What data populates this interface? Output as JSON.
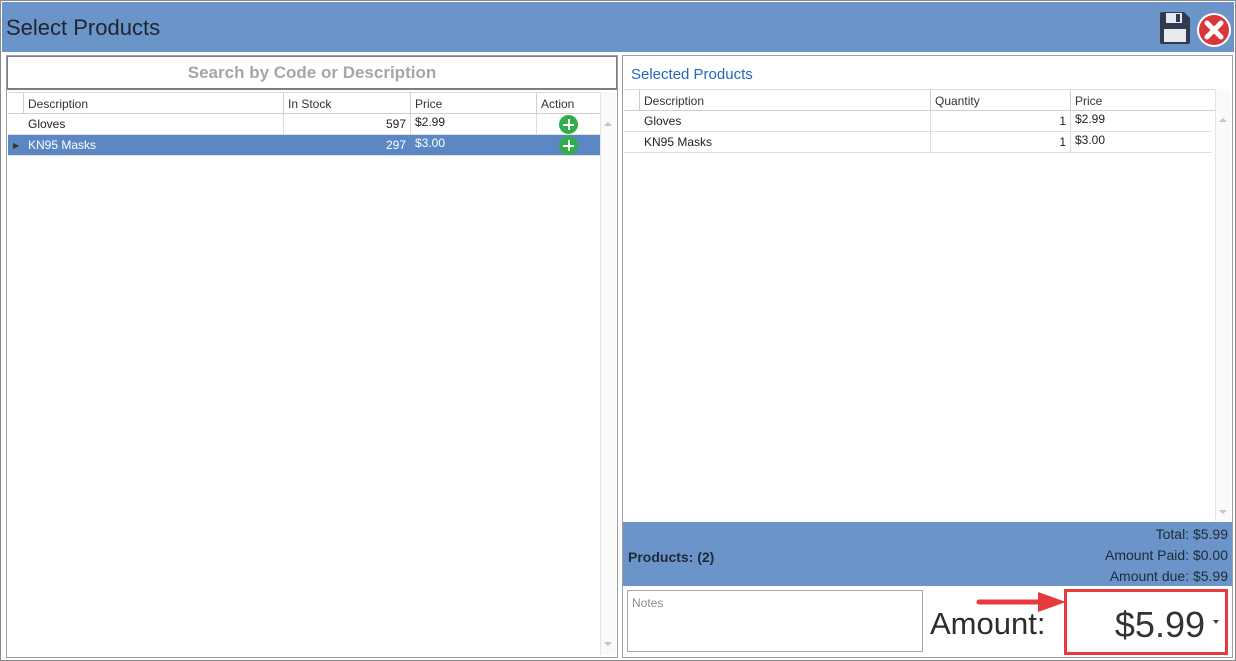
{
  "window": {
    "title": "Select Products"
  },
  "toolbar": {
    "save_icon": "floppy-disk-icon",
    "close_icon": "close-x-icon"
  },
  "search": {
    "placeholder": "Search by Code or Description"
  },
  "products_grid": {
    "columns": [
      "Description",
      "In Stock",
      "Price",
      "Action"
    ],
    "rows": [
      {
        "description": "Gloves",
        "in_stock": "597",
        "price": "$2.99",
        "selected": false
      },
      {
        "description": "KN95 Masks",
        "in_stock": "297",
        "price": "$3.00",
        "selected": true
      }
    ]
  },
  "selected_panel": {
    "title": "Selected Products",
    "columns": [
      "Description",
      "Quantity",
      "Price"
    ],
    "rows": [
      {
        "description": "Gloves",
        "quantity": "1",
        "price": "$2.99"
      },
      {
        "description": "KN95 Masks",
        "quantity": "1",
        "price": "$3.00"
      }
    ]
  },
  "summary": {
    "products_count": "Products: (2)",
    "total": "Total: $5.99",
    "amount_paid": "Amount Paid: $0.00",
    "amount_due": "Amount due: $5.99"
  },
  "payment": {
    "notes_placeholder": "Notes",
    "amount_label": "Amount:",
    "amount_value": "$5.99"
  },
  "colors": {
    "titlebar": "#6b95c9",
    "selected_row": "#5b88c4",
    "accent_text": "#2468b7",
    "add_button": "#2fae4a",
    "highlight": "#e8393d"
  }
}
